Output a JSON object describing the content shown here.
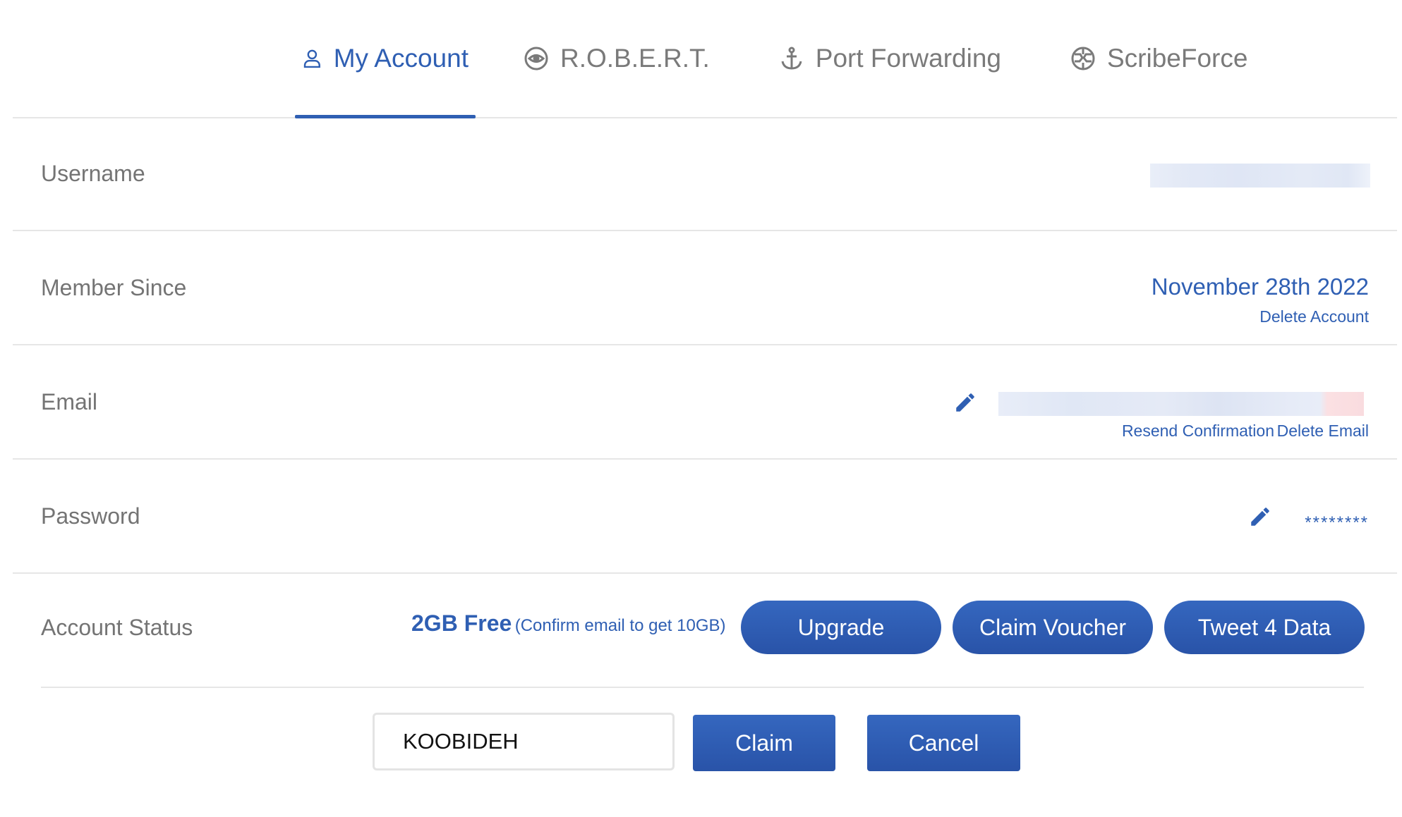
{
  "tabs": [
    {
      "label": "My Account",
      "icon": "user-icon",
      "active": true
    },
    {
      "label": "R.O.B.E.R.T.",
      "icon": "eye-icon",
      "active": false
    },
    {
      "label": "Port Forwarding",
      "icon": "anchor-icon",
      "active": false
    },
    {
      "label": "ScribeForce",
      "icon": "globe-icon",
      "active": false
    }
  ],
  "rows": {
    "username": {
      "label": "Username"
    },
    "member_since": {
      "label": "Member Since",
      "value": "November 28th 2022",
      "delete_account": "Delete Account"
    },
    "email": {
      "label": "Email",
      "resend": "Resend Confirmation",
      "delete_email": "Delete Email"
    },
    "password": {
      "label": "Password",
      "masked": "********"
    },
    "account_status": {
      "label": "Account Status",
      "plan": "2GB Free",
      "plan_note": "(Confirm email to get 10GB)",
      "upgrade": "Upgrade",
      "claim_voucher": "Claim Voucher",
      "tweet": "Tweet 4 Data"
    }
  },
  "voucher": {
    "value": "KOOBIDEH",
    "claim": "Claim",
    "cancel": "Cancel"
  },
  "colors": {
    "accent": "#2f5fb3",
    "text_muted": "#747474",
    "divider": "#e6e6e6"
  }
}
